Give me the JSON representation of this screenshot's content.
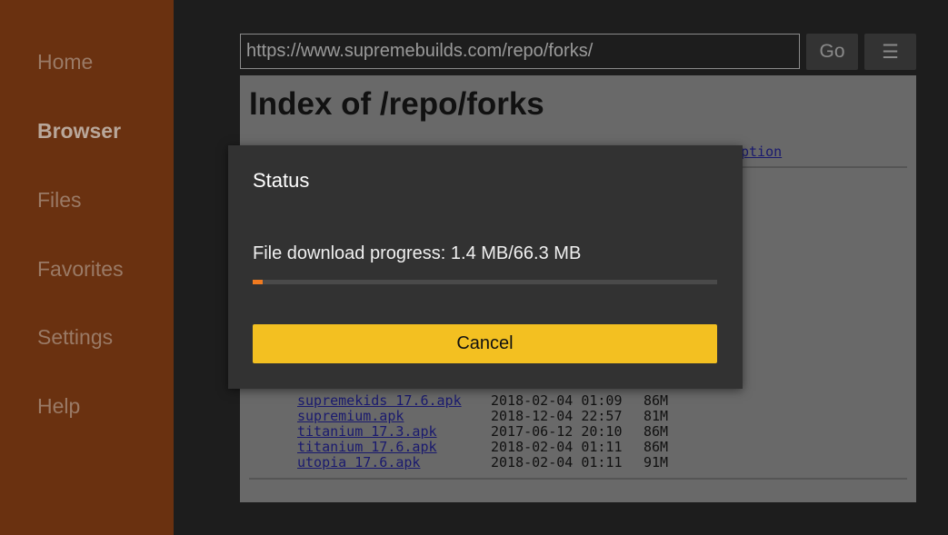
{
  "sidebar": {
    "items": [
      {
        "label": "Home"
      },
      {
        "label": "Browser",
        "active": true
      },
      {
        "label": "Files"
      },
      {
        "label": "Favorites"
      },
      {
        "label": "Settings"
      },
      {
        "label": "Help"
      }
    ]
  },
  "toolbar": {
    "url": "https://www.supremebuilds.com/repo/forks/",
    "go_label": "Go",
    "menu_icon": "hamburger-menu-icon"
  },
  "page": {
    "title": "Index of /repo/forks",
    "header_fragment": "ption",
    "rows": [
      {
        "name": "supremekids 17.6.apk",
        "date": "2018-02-04 01:09",
        "size": "86M"
      },
      {
        "name": "supremium.apk",
        "date": "2018-12-04 22:57",
        "size": "81M"
      },
      {
        "name": "titanium 17.3.apk",
        "date": "2017-06-12 20:10",
        "size": "86M"
      },
      {
        "name": "titanium 17.6.apk",
        "date": "2018-02-04 01:11",
        "size": "86M"
      },
      {
        "name": "utopia 17.6.apk",
        "date": "2018-02-04 01:11",
        "size": "91M"
      }
    ]
  },
  "dialog": {
    "title": "Status",
    "message": "File download progress: 1.4 MB/66.3 MB",
    "progress_percent": 2.1,
    "cancel_label": "Cancel",
    "accent": "#f07a20",
    "button_color": "#f3c021"
  }
}
